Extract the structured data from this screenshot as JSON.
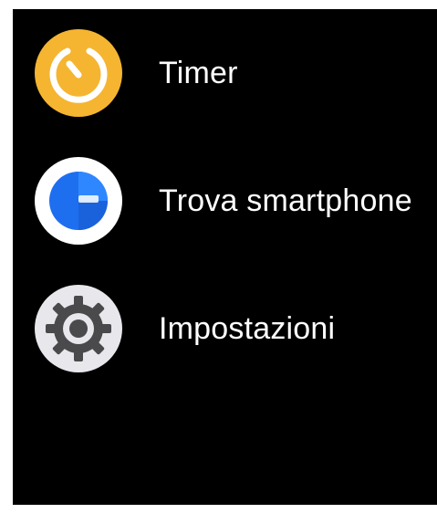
{
  "menu": {
    "items": [
      {
        "label": "Timer",
        "icon": "timer-icon"
      },
      {
        "label": "Trova smartphone",
        "icon": "find-phone-icon"
      },
      {
        "label": "Impostazioni",
        "icon": "settings-gear-icon"
      }
    ]
  },
  "colors": {
    "background": "#000000",
    "text": "#ffffff",
    "timer_icon_bg": "#F5B531",
    "find_icon_ring": "#FFFFFF",
    "find_icon_blue": "#1E6EF0",
    "settings_icon_bg": "#E8E8EC",
    "settings_gear": "#4A4A4D"
  }
}
